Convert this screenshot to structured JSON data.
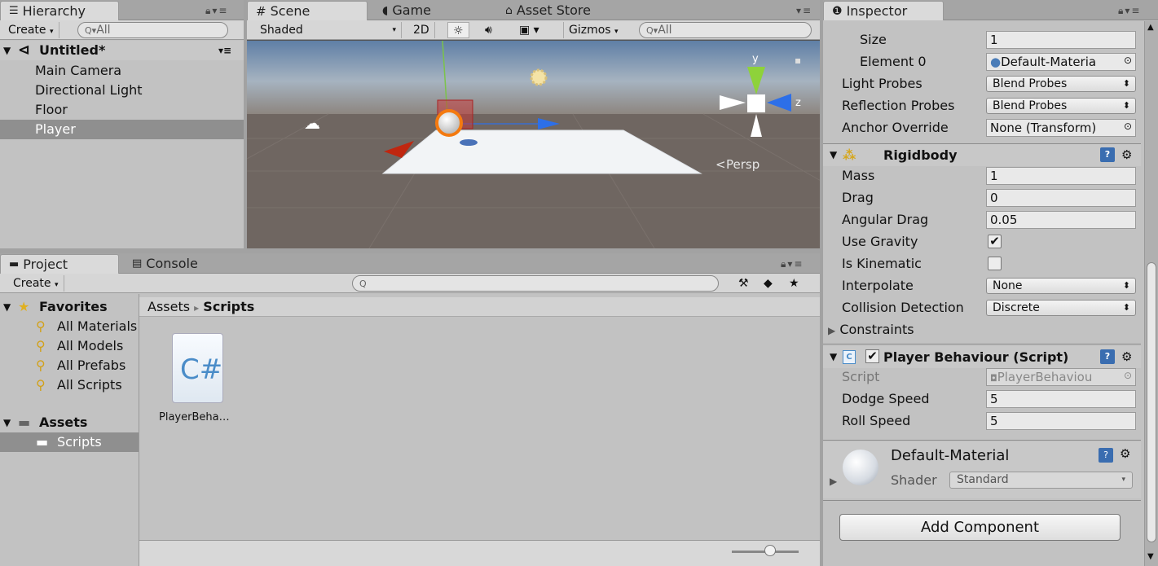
{
  "hierarchy": {
    "tab": "Hierarchy",
    "create": "Create",
    "search_placeholder": "All",
    "scene_name": "Untitled*",
    "items": [
      "Main Camera",
      "Directional Light",
      "Floor",
      "Player"
    ]
  },
  "scene": {
    "tabs": [
      "Scene",
      "Game",
      "Asset Store"
    ],
    "shading": "Shaded",
    "mode_2d": "2D",
    "gizmos": "Gizmos",
    "search_placeholder": "All",
    "persp": "Persp",
    "axis_y": "y",
    "axis_z": "z"
  },
  "project": {
    "tabs": [
      "Project",
      "Console"
    ],
    "create": "Create",
    "favorites_label": "Favorites",
    "favorites": [
      "All Materials",
      "All Models",
      "All Prefabs",
      "All Scripts"
    ],
    "assets_label": "Assets",
    "folders": [
      "Scripts"
    ],
    "breadcrumb": [
      "Assets",
      "Scripts"
    ],
    "breadcrumb_sep": "▸",
    "file_name": "PlayerBeha…",
    "file_glyph": "C#"
  },
  "inspector": {
    "tab": "Inspector",
    "renderer": {
      "size_label": "Size",
      "size_value": "1",
      "element0_label": "Element 0",
      "element0_value": "Default-Materia",
      "light_probes_label": "Light Probes",
      "light_probes_value": "Blend Probes",
      "reflection_probes_label": "Reflection Probes",
      "reflection_probes_value": "Blend Probes",
      "anchor_override_label": "Anchor Override",
      "anchor_override_value": "None (Transform)"
    },
    "rigidbody": {
      "title": "Rigidbody",
      "mass_label": "Mass",
      "mass": "1",
      "drag_label": "Drag",
      "drag": "0",
      "angular_drag_label": "Angular Drag",
      "angular_drag": "0.05",
      "use_gravity_label": "Use Gravity",
      "use_gravity": true,
      "is_kinematic_label": "Is Kinematic",
      "is_kinematic": false,
      "interpolate_label": "Interpolate",
      "interpolate": "None",
      "collision_label": "Collision Detection",
      "collision": "Discrete",
      "constraints_label": "Constraints"
    },
    "script": {
      "title": "Player Behaviour (Script)",
      "script_label": "Script",
      "script_value": "PlayerBehaviou",
      "dodge_label": "Dodge Speed",
      "dodge": "5",
      "roll_label": "Roll Speed",
      "roll": "5"
    },
    "material": {
      "name": "Default-Material",
      "shader_label": "Shader",
      "shader_value": "Standard"
    },
    "add_component": "Add Component"
  }
}
